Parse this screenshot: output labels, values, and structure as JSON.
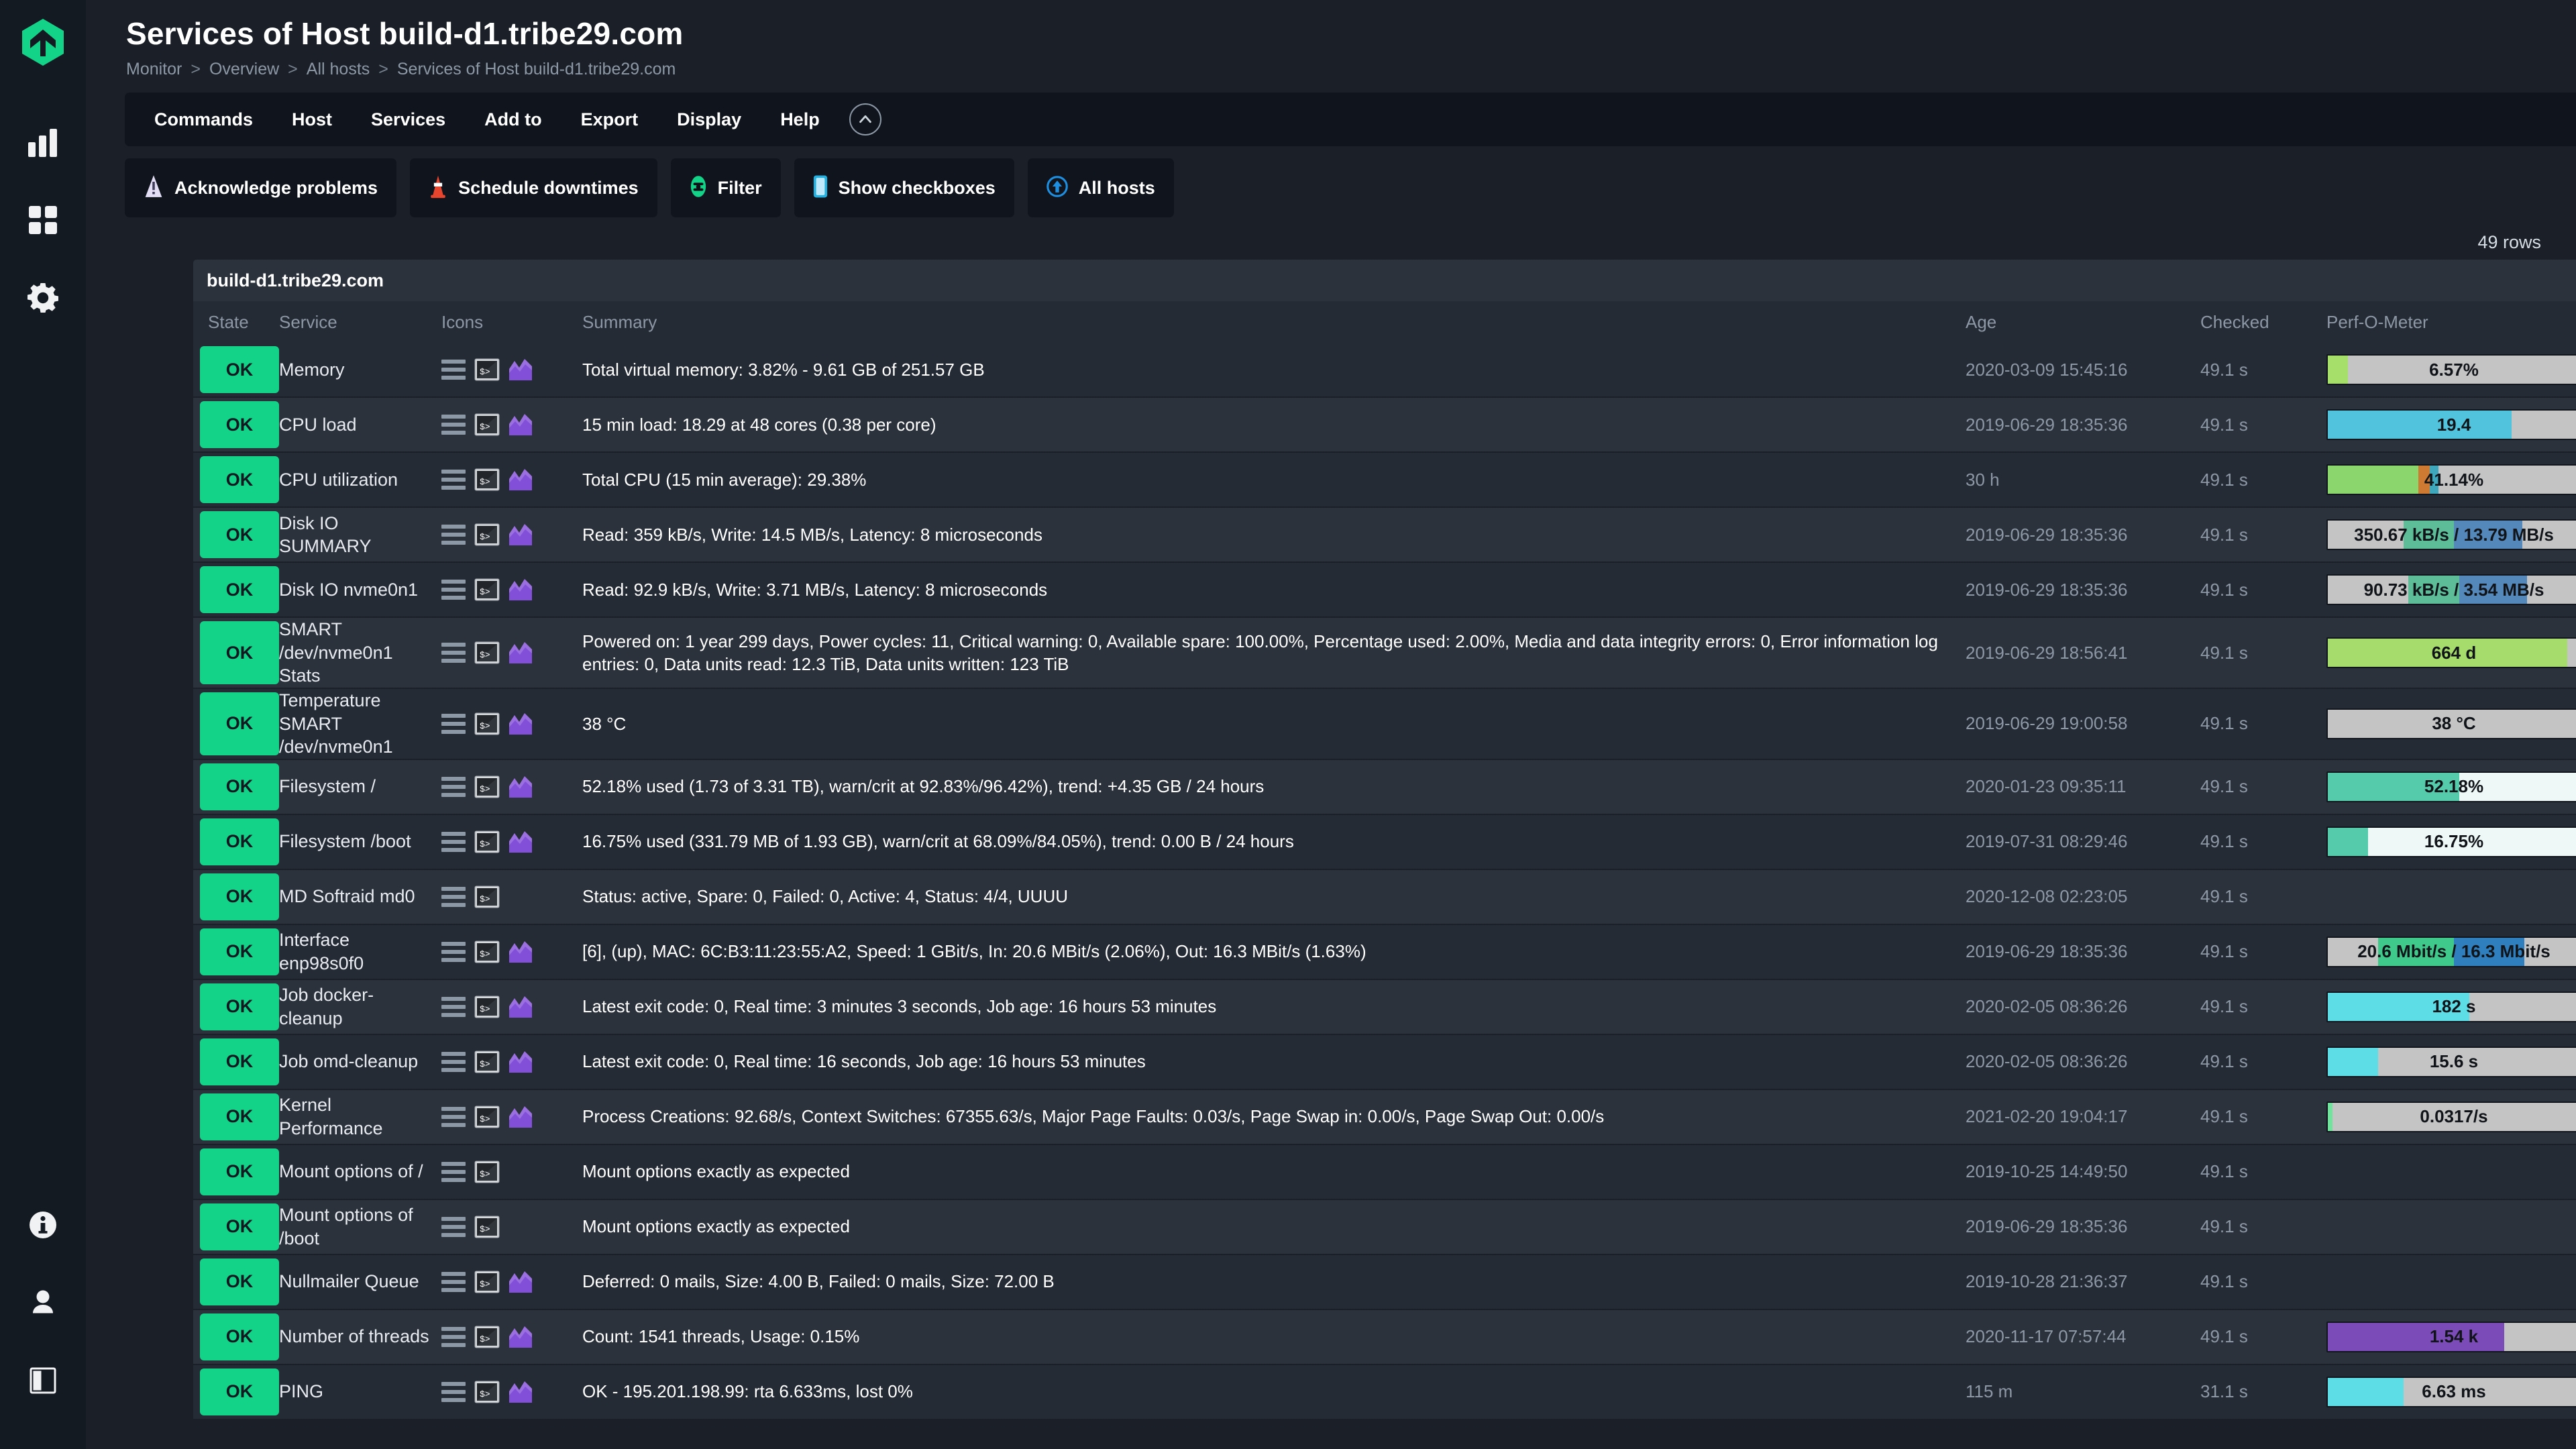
{
  "app": {
    "logo_icon": "checkmk-logo-icon",
    "accent_green": "#13d389",
    "bg": "#1b2028",
    "sidebar_bg": "#141a22"
  },
  "sidebar": {
    "items": [
      {
        "name": "sidebar-logo",
        "icon": "checkmk-logo-icon"
      },
      {
        "name": "sidebar-monitor",
        "icon": "bar-chart-icon"
      },
      {
        "name": "sidebar-dashboards",
        "icon": "grid-dashboard-icon"
      },
      {
        "name": "sidebar-setup",
        "icon": "gear-icon"
      }
    ],
    "bottom_items": [
      {
        "name": "sidebar-help",
        "icon": "info-circle-icon"
      },
      {
        "name": "sidebar-user",
        "icon": "user-icon"
      },
      {
        "name": "sidebar-toggle-panel",
        "icon": "sidebar-toggle-icon"
      }
    ]
  },
  "header": {
    "title": "Services of Host build-d1.tribe29.com",
    "breadcrumb": [
      "Monitor",
      "Overview",
      "All hosts",
      "Services of Host build-d1.tribe29.com"
    ],
    "breadcrumb_separator": ">"
  },
  "menubar": {
    "items": [
      "Commands",
      "Host",
      "Services",
      "Add to",
      "Export",
      "Display",
      "Help"
    ],
    "collapse_icon": "chevron-up-icon"
  },
  "toolbar": {
    "buttons": [
      {
        "label": "Acknowledge problems",
        "icon": "warning-triangle-icon",
        "color": "#e3def5"
      },
      {
        "label": "Schedule downtimes",
        "icon": "traffic-cone-icon",
        "color": "#e8452f"
      },
      {
        "label": "Filter",
        "icon": "filter-oval-icon",
        "color": "#13d389"
      },
      {
        "label": "Show checkboxes",
        "icon": "checkbox-icon",
        "color": "#21b0e0"
      },
      {
        "label": "All hosts",
        "icon": "arrow-up-circle-icon",
        "color": "#1e8fe0"
      }
    ]
  },
  "rows_count_label": "49 rows",
  "table": {
    "host_label": "build-d1.tribe29.com",
    "columns": [
      "State",
      "Service",
      "Icons",
      "Summary",
      "Age",
      "Checked",
      "Perf-O-Meter"
    ],
    "rows": [
      {
        "state": "OK",
        "service": "Memory",
        "icons": [
          "menu-icon",
          "terminal-icon",
          "graph-icon"
        ],
        "summary": "Total virtual memory: 3.82% - 9.61 GB of 251.57 GB",
        "age": "2020-03-09 15:45:16",
        "checked": "49.1 s",
        "perf": {
          "label": "6.57%",
          "segments": [
            {
              "pct": 8,
              "color": "#a6e06a"
            }
          ]
        }
      },
      {
        "state": "OK",
        "service": "CPU load",
        "icons": [
          "menu-icon",
          "terminal-icon",
          "graph-icon"
        ],
        "summary": "15 min load: 18.29 at 48 cores (0.38 per core)",
        "age": "2019-06-29 18:35:36",
        "checked": "49.1 s",
        "perf": {
          "label": "19.4",
          "segments": [
            {
              "pct": 73,
              "color": "#52c3dd"
            }
          ]
        }
      },
      {
        "state": "OK",
        "service": "CPU utilization",
        "icons": [
          "menu-icon",
          "terminal-icon",
          "graph-icon"
        ],
        "summary": "Total CPU (15 min average): 29.38%",
        "age": "30 h",
        "checked": "49.1 s",
        "perf": {
          "label": "41.14%",
          "segments": [
            {
              "pct": 36,
              "color": "#8cd66e"
            },
            {
              "pct": 4.5,
              "color": "#cf7a33"
            },
            {
              "pct": 3.5,
              "color": "#3fa7bb"
            }
          ]
        }
      },
      {
        "state": "OK",
        "service": "Disk IO SUMMARY",
        "icons": [
          "menu-icon",
          "terminal-icon",
          "graph-icon"
        ],
        "summary": "Read: 359 kB/s, Write: 14.5 MB/s, Latency: 8 microseconds",
        "age": "2019-06-29 18:35:36",
        "checked": "49.1 s",
        "perf": {
          "label": "350.67 kB/s / 13.79 MB/s",
          "segments": [
            {
              "pct": 30,
              "color": "#c4c4c4"
            },
            {
              "pct": 20,
              "color": "#5cbd98"
            },
            {
              "pct": 27,
              "color": "#5588ba"
            }
          ]
        }
      },
      {
        "state": "OK",
        "service": "Disk IO nvme0n1",
        "icons": [
          "menu-icon",
          "terminal-icon",
          "graph-icon"
        ],
        "summary": "Read: 92.9 kB/s, Write: 3.71 MB/s, Latency: 8 microseconds",
        "age": "2019-06-29 18:35:36",
        "checked": "49.1 s",
        "perf": {
          "label": "90.73 kB/s / 3.54 MB/s",
          "segments": [
            {
              "pct": 32,
              "color": "#c4c4c4"
            },
            {
              "pct": 20,
              "color": "#5cbd98"
            },
            {
              "pct": 27,
              "color": "#5588ba"
            }
          ]
        }
      },
      {
        "state": "OK",
        "service": "SMART /dev/nvme0n1 Stats",
        "icons": [
          "menu-icon",
          "terminal-icon",
          "graph-icon"
        ],
        "summary": "Powered on: 1 year 299 days, Power cycles: 11, Critical warning: 0, Available spare: 100.00%, Percentage used: 2.00%, Media and data integrity errors: 0, Error information log entries: 0, Data units read: 12.3 TiB, Data units written: 123 TiB",
        "age": "2019-06-29 18:56:41",
        "checked": "49.1 s",
        "perf": {
          "label": "664 d",
          "segments": [
            {
              "pct": 95,
              "color": "#a6dc6b"
            }
          ]
        }
      },
      {
        "state": "OK",
        "service": "Temperature SMART /dev/nvme0n1",
        "icons": [
          "menu-icon",
          "terminal-icon",
          "graph-icon"
        ],
        "summary": "38 °C",
        "age": "2019-06-29 19:00:58",
        "checked": "49.1 s",
        "perf": {
          "label": "38 °C",
          "segments": [
            {
              "pct": 48,
              "color": "#e0a council"
            }
          ]
        }
      },
      {
        "state": "OK",
        "service": "Filesystem /",
        "icons": [
          "menu-icon",
          "terminal-icon",
          "graph-icon"
        ],
        "summary": "52.18% used (1.73 of 3.31 TB), warn/crit at 92.83%/96.42%), trend: +4.35 GB / 24 hours",
        "age": "2020-01-23 09:35:11",
        "checked": "49.1 s",
        "perf": {
          "label": "52.18%",
          "segments": [
            {
              "pct": 52,
              "color": "#56cbac"
            }
          ],
          "track": "#eef9f7"
        }
      },
      {
        "state": "OK",
        "service": "Filesystem /boot",
        "icons": [
          "menu-icon",
          "terminal-icon",
          "graph-icon"
        ],
        "summary": "16.75% used (331.79 MB of 1.93 GB), warn/crit at 68.09%/84.05%), trend: 0.00 B / 24 hours",
        "age": "2019-07-31 08:29:46",
        "checked": "49.1 s",
        "perf": {
          "label": "16.75%",
          "segments": [
            {
              "pct": 16,
              "color": "#56cbac"
            }
          ],
          "track": "#eef9f7"
        }
      },
      {
        "state": "OK",
        "service": "MD Softraid md0",
        "icons": [
          "menu-icon",
          "terminal-icon"
        ],
        "summary": "Status: active, Spare: 0, Failed: 0, Active: 4, Status: 4/4, UUUU",
        "age": "2020-12-08 02:23:05",
        "checked": "49.1 s",
        "perf": null
      },
      {
        "state": "OK",
        "service": "Interface enp98s0f0",
        "icons": [
          "menu-icon",
          "terminal-icon",
          "graph-icon"
        ],
        "summary": "[6], (up), MAC: 6C:B3:11:23:55:A2, Speed: 1 GBit/s, In: 20.6 MBit/s (2.06%), Out: 16.3 MBit/s (1.63%)",
        "age": "2019-06-29 18:35:36",
        "checked": "49.1 s",
        "perf": {
          "label": "20.6 Mbit/s / 16.3 Mbit/s",
          "segments": [
            {
              "pct": 20,
              "color": "#c4c4c4"
            },
            {
              "pct": 30,
              "color": "#3fc98a"
            },
            {
              "pct": 28,
              "color": "#2f7fbe"
            }
          ]
        }
      },
      {
        "state": "OK",
        "service": "Job docker-cleanup",
        "icons": [
          "menu-icon",
          "terminal-icon",
          "graph-icon"
        ],
        "summary": "Latest exit code: 0, Real time: 3 minutes 3 seconds, Job age: 16 hours 53 minutes",
        "age": "2020-02-05 08:36:26",
        "checked": "49.1 s",
        "perf": {
          "label": "182 s",
          "segments": [
            {
              "pct": 56,
              "color": "#5ddde6"
            }
          ]
        }
      },
      {
        "state": "OK",
        "service": "Job omd-cleanup",
        "icons": [
          "menu-icon",
          "terminal-icon",
          "graph-icon"
        ],
        "summary": "Latest exit code: 0, Real time: 16 seconds, Job age: 16 hours 53 minutes",
        "age": "2020-02-05 08:36:26",
        "checked": "49.1 s",
        "perf": {
          "label": "15.6 s",
          "segments": [
            {
              "pct": 20,
              "color": "#5ddde6"
            }
          ]
        }
      },
      {
        "state": "OK",
        "service": "Kernel Performance",
        "icons": [
          "menu-icon",
          "terminal-icon",
          "graph-icon"
        ],
        "summary": "Process Creations: 92.68/s, Context Switches: 67355.63/s, Major Page Faults: 0.03/s, Page Swap in: 0.00/s, Page Swap Out: 0.00/s",
        "age": "2021-02-20 19:04:17",
        "checked": "49.1 s",
        "perf": {
          "label": "0.0317/s",
          "segments": [
            {
              "pct": 1.8,
              "color": "#72e39c"
            }
          ]
        }
      },
      {
        "state": "OK",
        "service": "Mount options of /",
        "icons": [
          "menu-icon",
          "terminal-icon"
        ],
        "summary": "Mount options exactly as expected",
        "age": "2019-10-25 14:49:50",
        "checked": "49.1 s",
        "perf": null
      },
      {
        "state": "OK",
        "service": "Mount options of /boot",
        "icons": [
          "menu-icon",
          "terminal-icon"
        ],
        "summary": "Mount options exactly as expected",
        "age": "2019-06-29 18:35:36",
        "checked": "49.1 s",
        "perf": null
      },
      {
        "state": "OK",
        "service": "Nullmailer Queue",
        "icons": [
          "menu-icon",
          "terminal-icon",
          "graph-icon"
        ],
        "summary": "Deferred: 0 mails, Size: 4.00 B, Failed: 0 mails, Size: 72.00 B",
        "age": "2019-10-28 21:36:37",
        "checked": "49.1 s",
        "perf": null
      },
      {
        "state": "OK",
        "service": "Number of threads",
        "icons": [
          "menu-icon",
          "terminal-icon",
          "graph-icon"
        ],
        "summary": "Count: 1541 threads, Usage: 0.15%",
        "age": "2020-11-17 07:57:44",
        "checked": "49.1 s",
        "perf": {
          "label": "1.54 k",
          "segments": [
            {
              "pct": 70,
              "color": "#7b4cb8"
            }
          ]
        }
      },
      {
        "state": "OK",
        "service": "PING",
        "icons": [
          "menu-icon",
          "terminal-icon",
          "graph-icon"
        ],
        "summary": "OK - 195.201.198.99: rta 6.633ms, lost 0%",
        "age": "115 m",
        "checked": "31.1 s",
        "perf": {
          "label": "6.63 ms",
          "segments": [
            {
              "pct": 30,
              "color": "#5ddde6"
            }
          ]
        }
      }
    ]
  }
}
